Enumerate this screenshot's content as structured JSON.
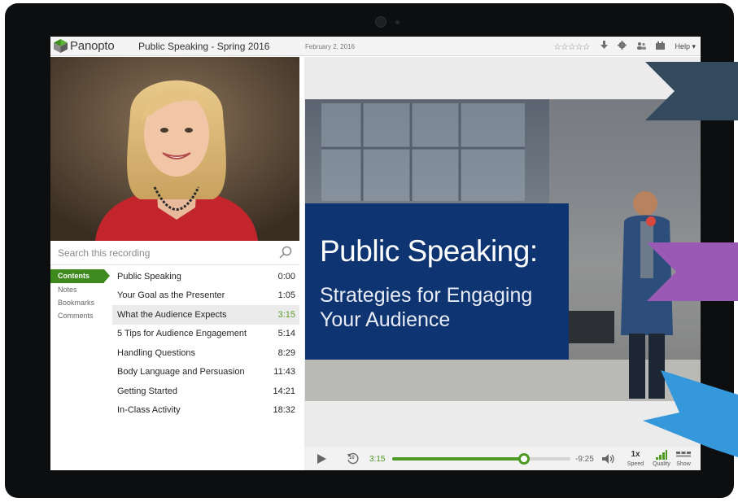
{
  "header": {
    "brand": "Panopto",
    "course_title": "Public Speaking - Spring 2016",
    "date": "February 2, 2016",
    "rating_stars": "☆☆☆☆☆",
    "help_label": "Help ▾",
    "icons": [
      "download-icon",
      "settings-icon",
      "people-icon",
      "layout-icon"
    ]
  },
  "search": {
    "placeholder": "Search this recording"
  },
  "side_tabs": [
    {
      "label": "Contents",
      "active": true
    },
    {
      "label": "Notes",
      "active": false
    },
    {
      "label": "Bookmarks",
      "active": false
    },
    {
      "label": "Comments",
      "active": false
    }
  ],
  "contents": [
    {
      "title": "Public Speaking",
      "time": "0:00",
      "selected": false
    },
    {
      "title": "Your Goal as the Presenter",
      "time": "1:05",
      "selected": false
    },
    {
      "title": "What the Audience Expects",
      "time": "3:15",
      "selected": true
    },
    {
      "title": "5 Tips for Audience Engagement",
      "time": "5:14",
      "selected": false
    },
    {
      "title": "Handling Questions",
      "time": "8:29",
      "selected": false
    },
    {
      "title": "Body Language and Persuasion",
      "time": "11:43",
      "selected": false
    },
    {
      "title": "Getting Started",
      "time": "14:21",
      "selected": false
    },
    {
      "title": "In-Class Activity",
      "time": "18:32",
      "selected": false
    }
  ],
  "slide": {
    "title": "Public Speaking:",
    "subtitle": "Strategies for Engaging Your Audience"
  },
  "player": {
    "current_time": "3:15",
    "remaining_time": "-9:25",
    "progress_fraction": 0.74,
    "speed_value": "1x",
    "speed_label": "Speed",
    "quality_label": "Quality",
    "show_label": "Show",
    "rewind_badge": "10"
  },
  "colors": {
    "accent_green": "#4d9a23",
    "slide_blue": "#0f3472",
    "arrow_navy": "#34495e",
    "arrow_purple": "#9b59b6",
    "arrow_blue": "#3498db"
  }
}
